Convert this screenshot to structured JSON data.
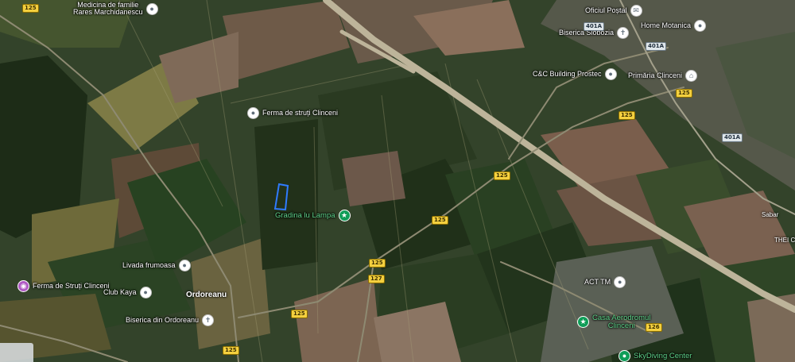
{
  "pois": [
    {
      "id": "medicina",
      "label": "Medicina de familie\nRares Marchidanescu",
      "icon": "place-marker-icon",
      "style": "grey"
    },
    {
      "id": "ferma-struti",
      "label": "Ferma de struți Clinceni",
      "icon": "place-marker-icon",
      "style": "grey"
    },
    {
      "id": "gradina",
      "label": "Gradina lu Lampa",
      "icon": "star-icon",
      "style": "green"
    },
    {
      "id": "livada",
      "label": "Livada frumoasa",
      "icon": "place-marker-icon",
      "style": "grey"
    },
    {
      "id": "ferma-struti-2",
      "label": "Ferma de Struți Clinceni",
      "icon": "camera-icon",
      "style": "purple"
    },
    {
      "id": "club-kaya",
      "label": "Club Kaya",
      "icon": "place-marker-icon",
      "style": "grey"
    },
    {
      "id": "biserica-ordoreanu",
      "label": "Biserica din Ordoreanu",
      "icon": "cross-icon",
      "style": "grey"
    },
    {
      "id": "oficiu-postal",
      "label": "Oficiul Poștal",
      "icon": "envelope-icon",
      "style": "grey"
    },
    {
      "id": "biserica-slobozia",
      "label": "Biserica Slobozia",
      "icon": "cross-icon",
      "style": "grey"
    },
    {
      "id": "home-motanica",
      "label": "Home Motanica",
      "icon": "place-marker-icon",
      "style": "grey"
    },
    {
      "id": "cc-building",
      "label": "C&C Building Prostec",
      "icon": "place-marker-icon",
      "style": "grey"
    },
    {
      "id": "primaria",
      "label": "Primăria Clinceni",
      "icon": "government-icon",
      "style": "grey"
    },
    {
      "id": "acttm",
      "label": "ACT TM",
      "icon": "place-marker-icon",
      "style": "grey"
    },
    {
      "id": "casa-aerodromul",
      "label": "Casa Aerodromul\nClinceni",
      "icon": "star-icon",
      "style": "green"
    },
    {
      "id": "skydiving",
      "label": "SkyDiving Center",
      "icon": "place-marker-icon",
      "style": "green"
    }
  ],
  "places": [
    {
      "id": "ordoreanu",
      "label": "Ordoreanu"
    },
    {
      "id": "sabar",
      "label": "Sabar"
    },
    {
      "id": "thei",
      "label": "THEI CLI"
    }
  ],
  "road_shields": [
    {
      "id": "r125-top",
      "label": "125"
    },
    {
      "id": "r401a-a",
      "label": "401A"
    },
    {
      "id": "r401a-b",
      "label": "401A"
    },
    {
      "id": "r125-prim",
      "label": "125"
    },
    {
      "id": "r401a-c",
      "label": "401A"
    },
    {
      "id": "r125-mid",
      "label": "125"
    },
    {
      "id": "r125-c",
      "label": "125"
    },
    {
      "id": "r125-d",
      "label": "125"
    },
    {
      "id": "r125-e",
      "label": "125"
    },
    {
      "id": "r127",
      "label": "127"
    },
    {
      "id": "r125-f",
      "label": "125"
    },
    {
      "id": "r125-g",
      "label": "125"
    },
    {
      "id": "r126",
      "label": "126"
    }
  ],
  "icons": {
    "place-marker-icon": "●",
    "star-icon": "★",
    "cross-icon": "✝",
    "envelope-icon": "✉",
    "government-icon": "⌂",
    "camera-icon": "◉"
  },
  "colors": {
    "field_dark": "#26351c",
    "field_mid": "#3e4f2c",
    "field_light": "#6b6a3e",
    "field_brown": "#7a6248",
    "road": "#c8bfa4",
    "poi_green": "#0f9d58",
    "selection_outline": "#2f7bff"
  }
}
